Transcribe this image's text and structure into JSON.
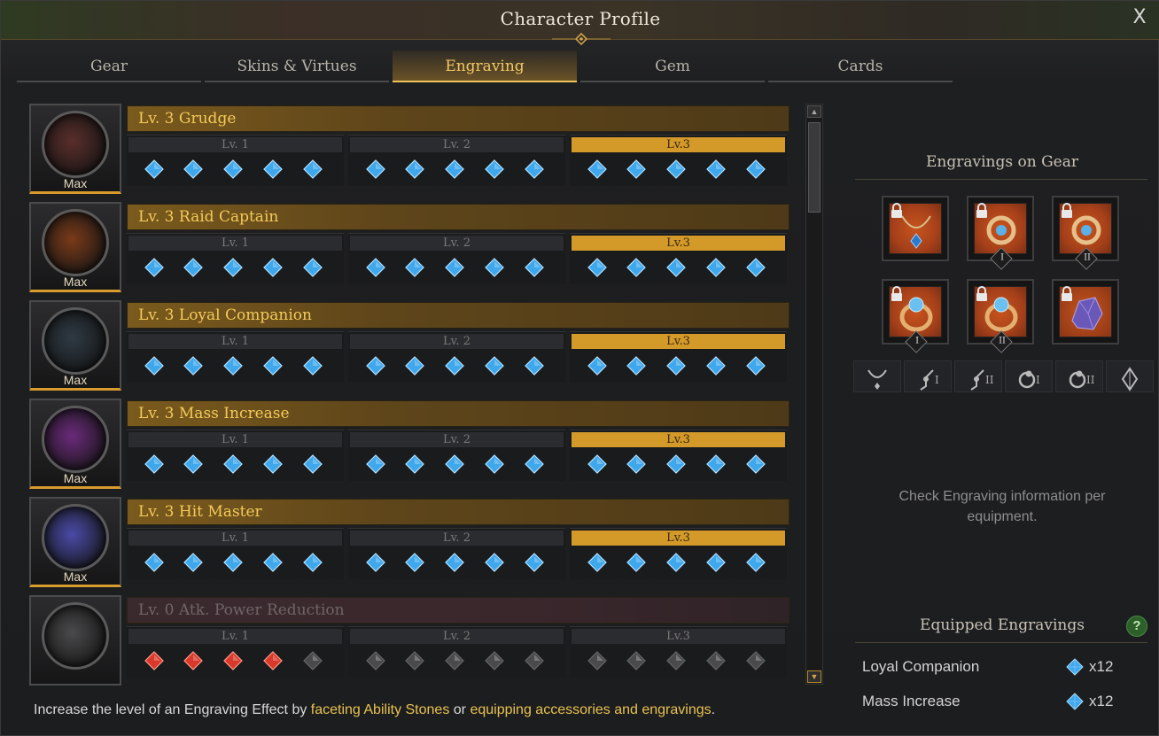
{
  "window": {
    "title": "Character Profile",
    "close_label": "X"
  },
  "tabs": [
    {
      "label": "Gear",
      "active": false
    },
    {
      "label": "Skins & Virtues",
      "active": false
    },
    {
      "label": "Engraving",
      "active": true
    },
    {
      "label": "Gem",
      "active": false
    },
    {
      "label": "Cards",
      "active": false
    }
  ],
  "engravings": [
    {
      "name": "Lv. 3 Grudge",
      "badge": "Max",
      "active": true,
      "icon": "grudge-engraving-icon",
      "orb_color": "#5a2e2a",
      "levels": [
        "Lv. 1",
        "Lv. 2",
        "Lv.3"
      ],
      "highlighted_level": 3,
      "filled_nodes": 15
    },
    {
      "name": "Lv. 3 Raid Captain",
      "badge": "Max",
      "active": true,
      "icon": "raid-captain-engraving-icon",
      "orb_color": "#7a3a18",
      "levels": [
        "Lv. 1",
        "Lv. 2",
        "Lv.3"
      ],
      "highlighted_level": 3,
      "filled_nodes": 15
    },
    {
      "name": "Lv. 3 Loyal Companion",
      "badge": "Max",
      "active": true,
      "icon": "loyal-companion-engraving-icon",
      "orb_color": "#2e3a44",
      "levels": [
        "Lv. 1",
        "Lv. 2",
        "Lv.3"
      ],
      "highlighted_level": 3,
      "filled_nodes": 15
    },
    {
      "name": "Lv. 3 Mass Increase",
      "badge": "Max",
      "active": true,
      "icon": "mass-increase-engraving-icon",
      "orb_color": "#6a2a7a",
      "levels": [
        "Lv. 1",
        "Lv. 2",
        "Lv.3"
      ],
      "highlighted_level": 3,
      "filled_nodes": 15
    },
    {
      "name": "Lv. 3 Hit Master",
      "badge": "Max",
      "active": true,
      "icon": "hit-master-engraving-icon",
      "orb_color": "#4a4aa8",
      "levels": [
        "Lv. 1",
        "Lv. 2",
        "Lv.3"
      ],
      "highlighted_level": 3,
      "filled_nodes": 15
    },
    {
      "name": "Lv. 0 Atk. Power Reduction",
      "badge": "",
      "active": false,
      "icon": "atk-power-reduction-engraving-icon",
      "orb_color": "#4a4a4c",
      "levels": [
        "Lv. 1",
        "Lv. 2",
        "Lv.3"
      ],
      "highlighted_level": 0,
      "filled_nodes": 4
    }
  ],
  "gems": {
    "active_color": "#3fa8ec",
    "negative_color": "#d8392b",
    "empty_color": "#4a4a4c"
  },
  "right_panel": {
    "gear_title": "Engravings on Gear",
    "gear_slots": [
      {
        "item": "necklace-icon",
        "tier": ""
      },
      {
        "item": "earring-icon",
        "tier": "I"
      },
      {
        "item": "earring-icon",
        "tier": "II"
      },
      {
        "item": "ring-icon",
        "tier": "I"
      },
      {
        "item": "ring-icon",
        "tier": "II"
      },
      {
        "item": "ability-stone-icon",
        "tier": ""
      }
    ],
    "filters": [
      {
        "icon": "necklace-filter-icon",
        "sub": ""
      },
      {
        "icon": "earring-filter-icon",
        "sub": "I"
      },
      {
        "icon": "earring-filter-icon",
        "sub": "II"
      },
      {
        "icon": "ring-filter-icon",
        "sub": "I"
      },
      {
        "icon": "ring-filter-icon",
        "sub": "II"
      },
      {
        "icon": "stone-filter-icon",
        "sub": ""
      }
    ],
    "info_text": "Check Engraving information per equipment.",
    "equipped_title": "Equipped Engravings",
    "help_label": "?",
    "equipped": [
      {
        "name": "Loyal Companion",
        "count": "x12"
      },
      {
        "name": "Mass Increase",
        "count": "x12"
      }
    ]
  },
  "footer": {
    "prefix": "Increase the level of an Engraving Effect by ",
    "link1": "faceting Ability Stones",
    "middle": " or ",
    "link2": "equipping accessories and engravings",
    "suffix": "."
  }
}
